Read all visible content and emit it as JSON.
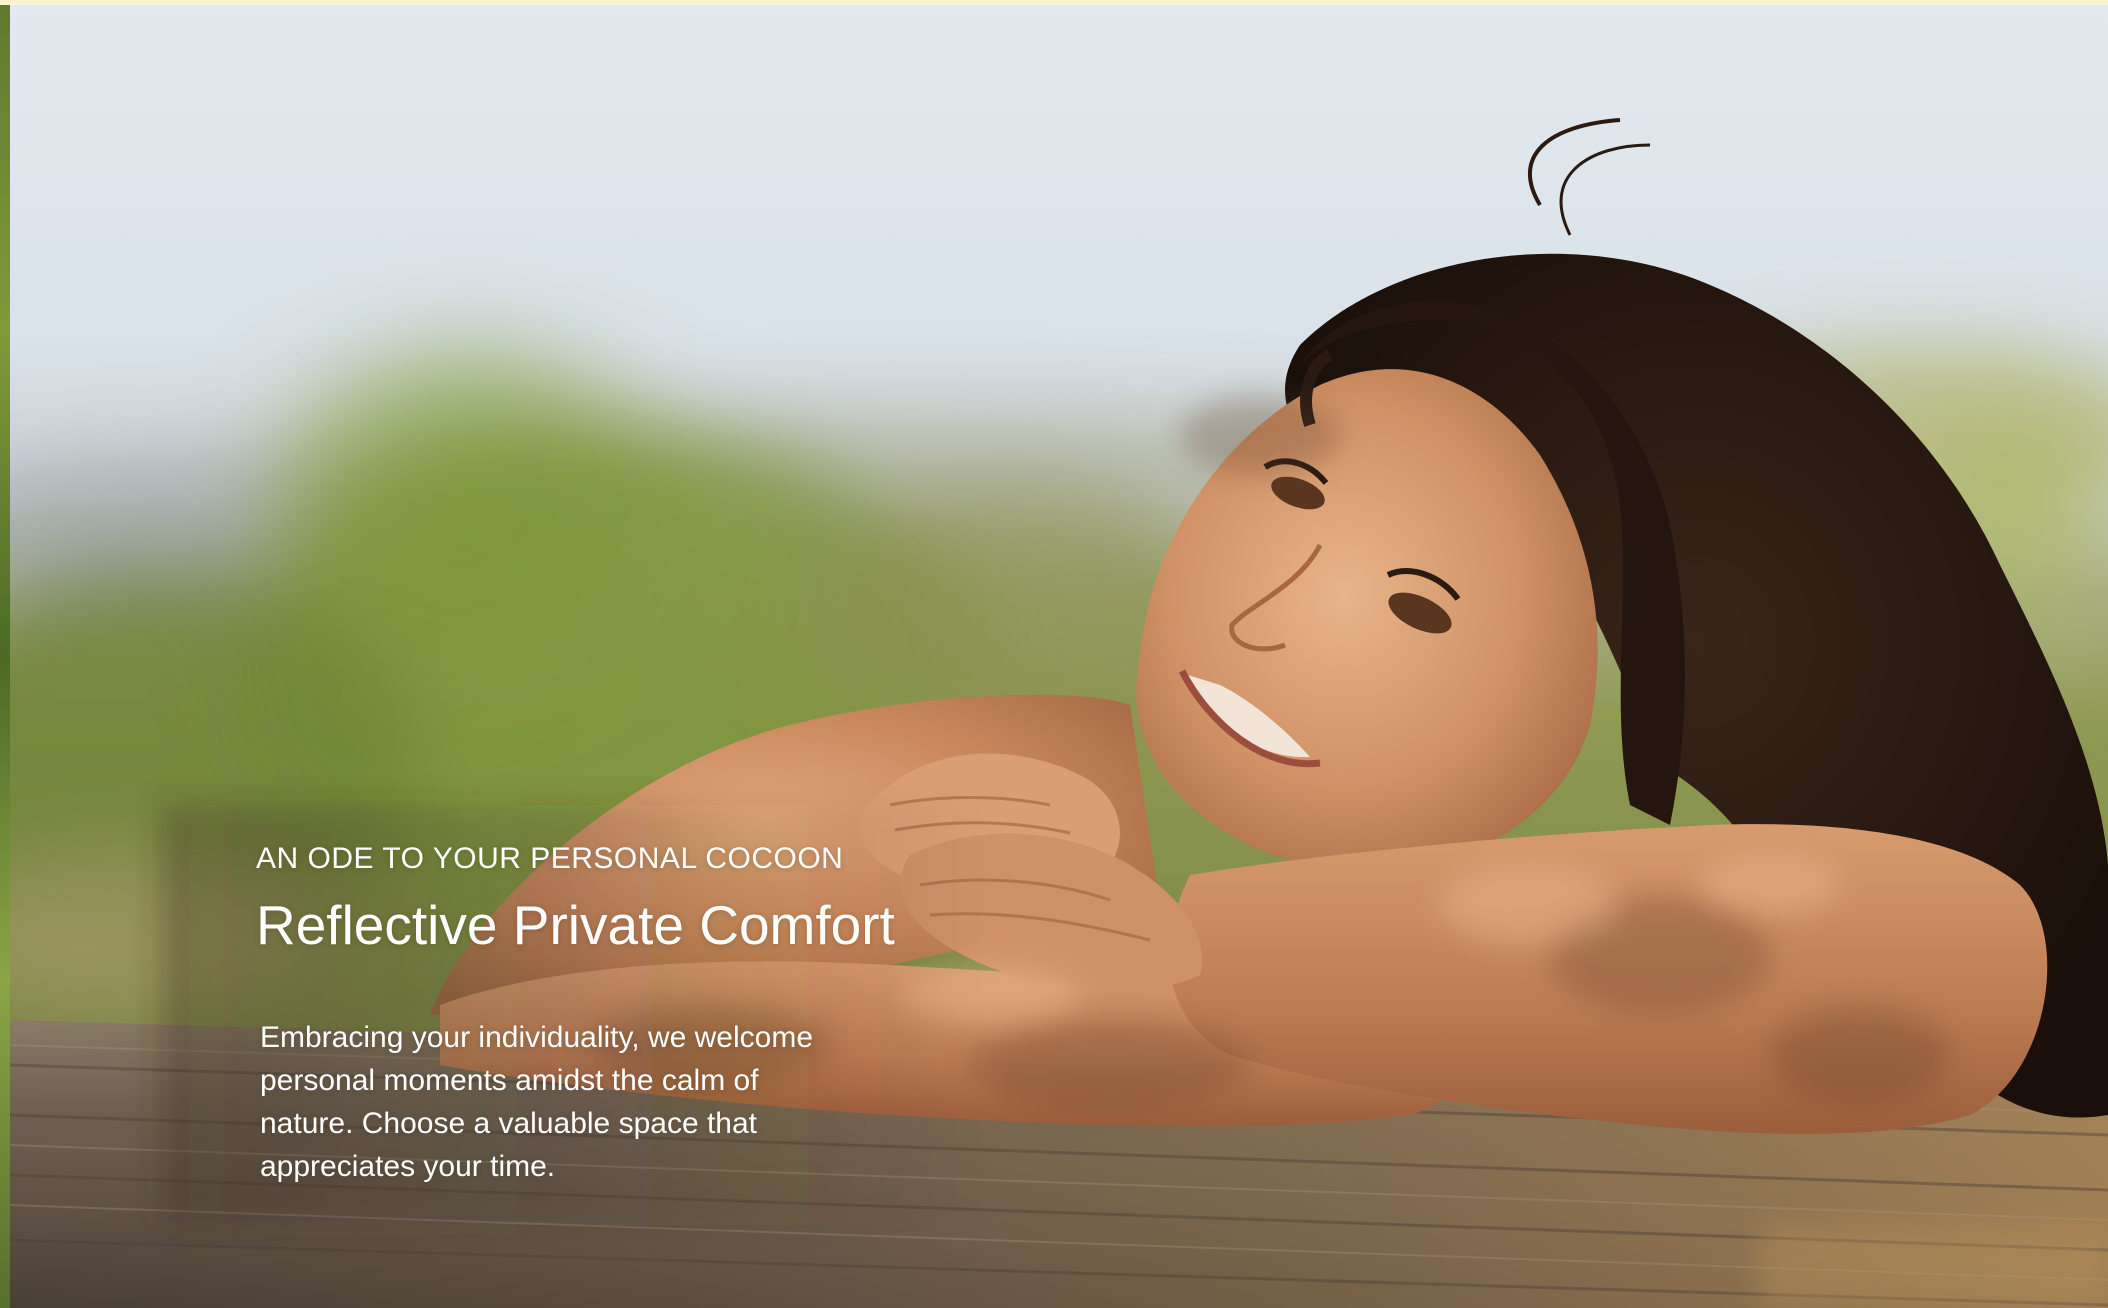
{
  "hero": {
    "eyebrow": "AN ODE TO YOUR PERSONAL COCOON",
    "headline": "Reflective Private Comfort",
    "body_lines": [
      "Embracing your individuality, we welcome",
      "personal moments amidst the calm of",
      "nature. Choose a valuable space that",
      "appreciates your time."
    ]
  },
  "colors": {
    "sky": "#dde4ea",
    "foliage": "#8a9a3e",
    "skin": "#c98a5e",
    "hair": "#2a1a12",
    "wood": "#6e5a48",
    "text": "#ffffff",
    "top_strip": "#fbf0cf"
  }
}
